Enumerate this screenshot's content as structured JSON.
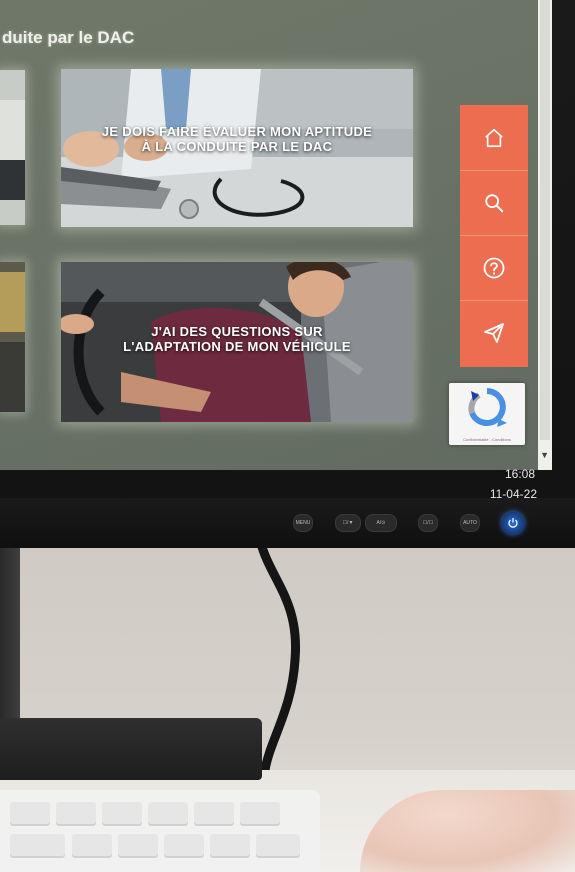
{
  "screen": {
    "heading": "duite par le DAC",
    "tiles": [
      {
        "label": "JE DOIS FAIRE ÉVALUER MON APTITUDE À LA CONDUITE PAR LE DAC"
      },
      {
        "label": "J'AI DES QUESTIONS SUR L'ADAPTATION DE MON VÉHICULE"
      }
    ],
    "side_menu": {
      "color": "#ec6d4f",
      "items": [
        {
          "icon": "home-icon"
        },
        {
          "icon": "search-icon"
        },
        {
          "icon": "help-icon"
        },
        {
          "icon": "send-icon"
        }
      ]
    },
    "recaptcha": {
      "links": "Confidentialité - Conditions"
    }
  },
  "taskbar": {
    "time": "16:08",
    "date": "11-04-22"
  },
  "monitor_buttons": {
    "menu": "MENU",
    "input": "☐/▼",
    "brightness": "A/⊙",
    "mode": "☐/☐",
    "auto": "AUTO"
  }
}
